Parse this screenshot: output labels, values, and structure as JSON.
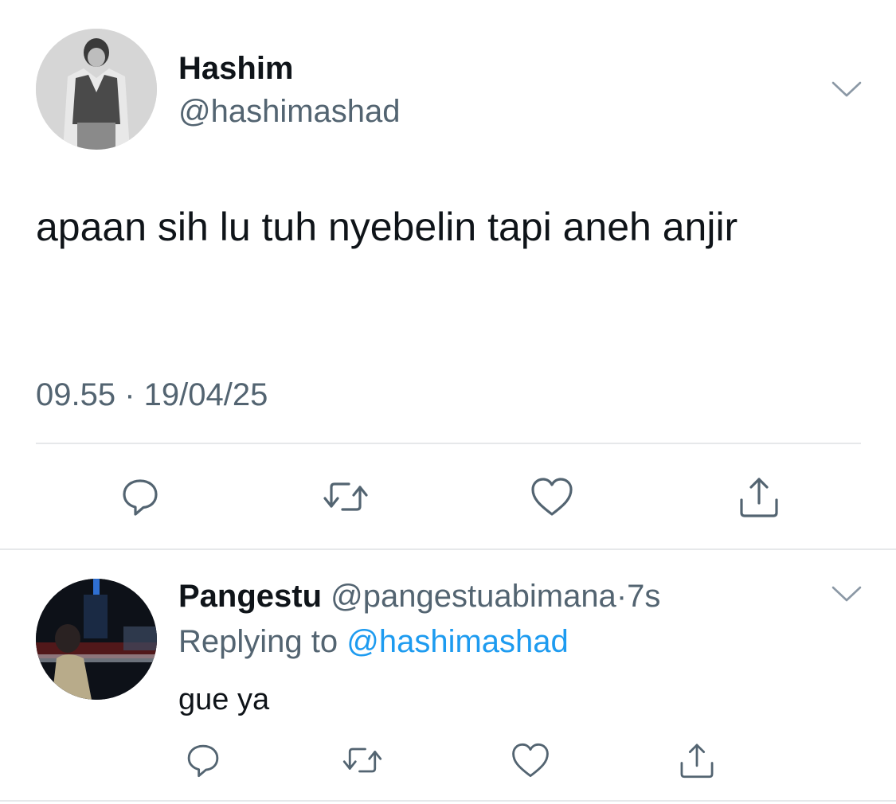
{
  "main_tweet": {
    "display_name": "Hashim",
    "handle": "@hashimashad",
    "text": "apaan sih lu tuh nyebelin tapi aneh anjir",
    "timestamp": "09.55 · 19/04/25",
    "avatar_icon": "profile-photo",
    "menu_icon": "chevron-down-icon",
    "actions": {
      "reply_icon": "reply-icon",
      "retweet_icon": "retweet-icon",
      "like_icon": "heart-icon",
      "share_icon": "share-icon"
    }
  },
  "reply_tweet": {
    "display_name": "Pangestu",
    "handle": "@pangestuabimana",
    "separator": "·",
    "time": "7s",
    "replying_label": "Replying to",
    "replying_to": "@hashimashad",
    "text": "gue ya",
    "avatar_icon": "profile-photo",
    "menu_icon": "chevron-down-icon",
    "actions": {
      "reply_icon": "reply-icon",
      "retweet_icon": "retweet-icon",
      "like_icon": "heart-icon",
      "share_icon": "share-icon"
    }
  },
  "colors": {
    "text_primary": "#0f1419",
    "text_secondary": "#536471",
    "link": "#1d9bf0",
    "divider": "#e6e8ea",
    "icon": "#536471"
  }
}
